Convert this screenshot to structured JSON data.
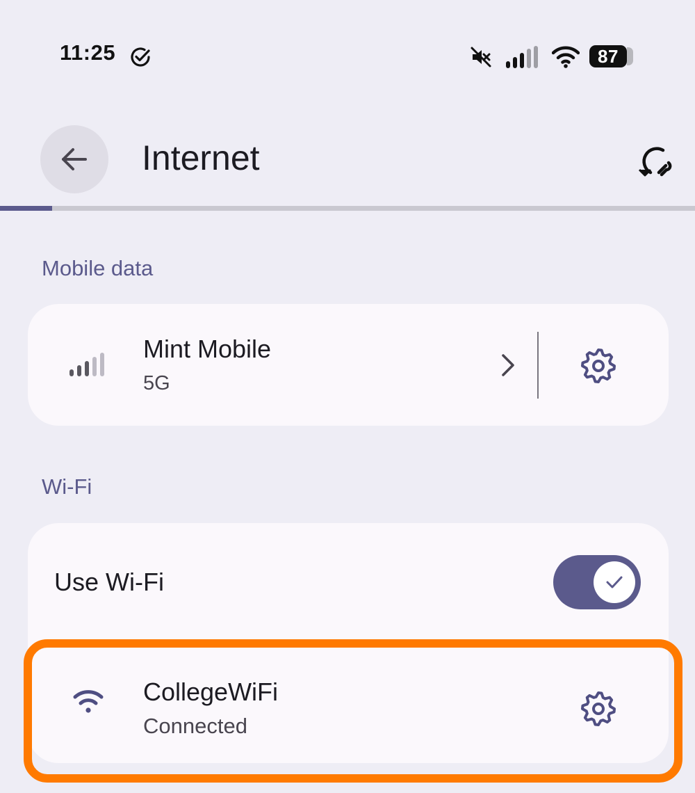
{
  "status_bar": {
    "time": "11:25",
    "battery_level": "87",
    "icons": [
      "check-circle-icon",
      "mute-icon",
      "cellular-signal-icon",
      "wifi-icon",
      "battery-icon"
    ]
  },
  "app_bar": {
    "title": "Internet",
    "back_icon": "arrow-back-icon",
    "action_icon": "network-reset-icon",
    "progress_fraction": 0.075
  },
  "mobile_data": {
    "header": "Mobile data",
    "carrier": "Mint Mobile",
    "network_type": "5G",
    "icons": [
      "cellular-signal-icon",
      "chevron-right-icon",
      "gear-icon"
    ]
  },
  "wifi": {
    "header": "Wi-Fi",
    "toggle_label": "Use Wi-Fi",
    "toggle_on": true,
    "network": {
      "name": "CollegeWiFi",
      "status": "Connected",
      "icons": [
        "wifi-icon",
        "gear-icon"
      ]
    }
  },
  "colors": {
    "accent": "#5b5a8c",
    "background": "#eeedf5",
    "card": "#fbf8fc",
    "highlight": "#ff7a00"
  }
}
